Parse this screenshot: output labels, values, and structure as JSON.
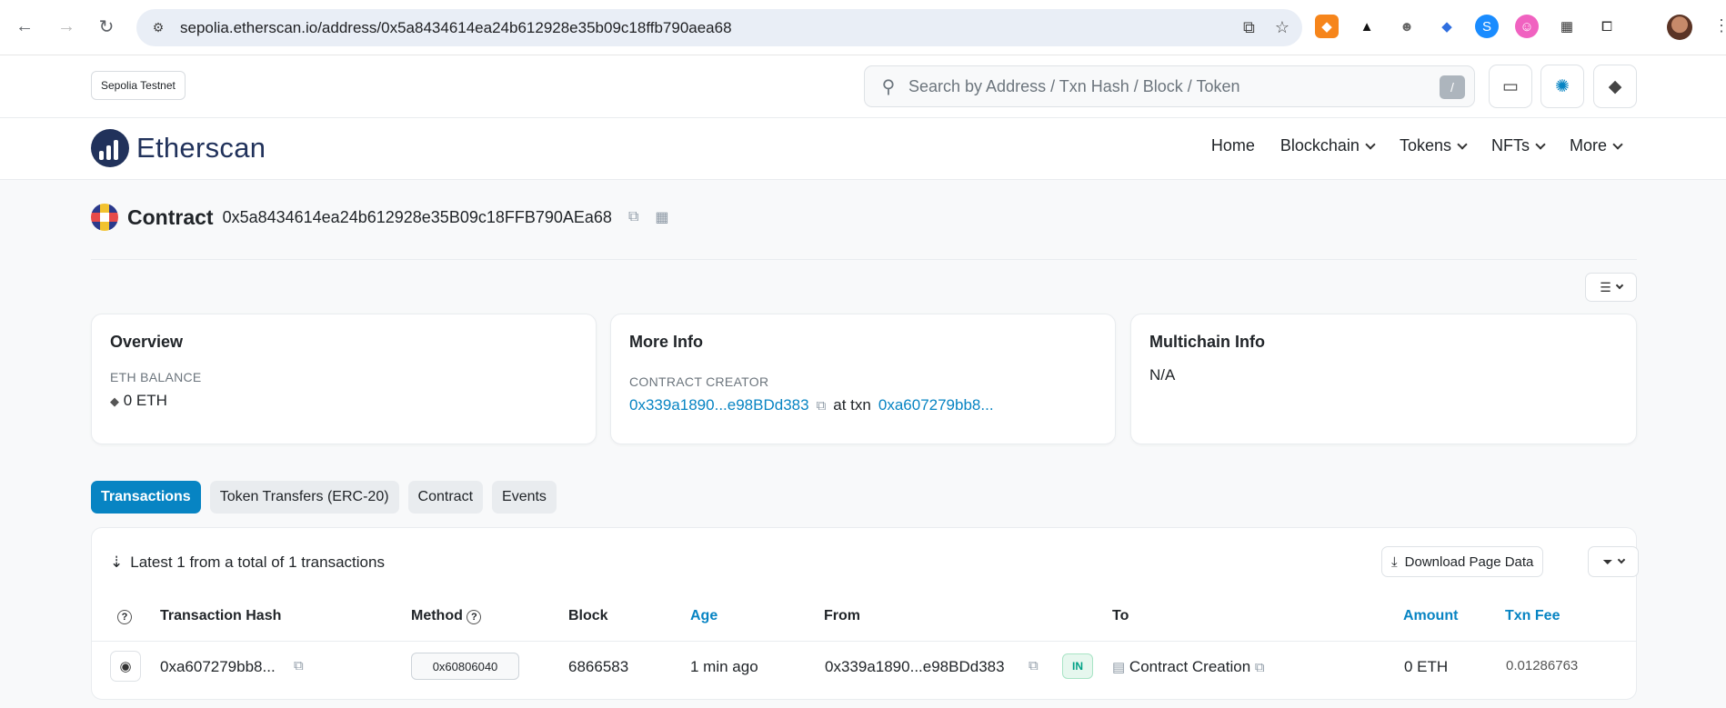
{
  "browser": {
    "url": "sepolia.etherscan.io/address/0x5a8434614ea24b612928e35b09c18ffb790aea68"
  },
  "header": {
    "network": "Sepolia Testnet",
    "search_placeholder": "Search by Address / Txn Hash / Block / Token",
    "search_shortcut": "/"
  },
  "nav": {
    "brand": "Etherscan",
    "items": [
      "Home",
      "Blockchain",
      "Tokens",
      "NFTs",
      "More"
    ]
  },
  "contract": {
    "title": "Contract",
    "address": "0x5a8434614ea24b612928e35B09c18FFB790AEa68"
  },
  "overview": {
    "title": "Overview",
    "balance_label": "ETH BALANCE",
    "balance_value": "0 ETH"
  },
  "more_info": {
    "title": "More Info",
    "creator_label": "CONTRACT CREATOR",
    "creator": "0x339a1890...e98BDd383",
    "at_txn": "at txn",
    "txn": "0xa607279bb8..."
  },
  "multichain": {
    "title": "Multichain Info",
    "value": "N/A"
  },
  "tabs": [
    "Transactions",
    "Token Transfers (ERC-20)",
    "Contract",
    "Events"
  ],
  "transactions": {
    "summary": "Latest 1 from a total of 1 transactions",
    "download_label": "Download Page Data",
    "columns": {
      "hash": "Transaction Hash",
      "method": "Method",
      "block": "Block",
      "age": "Age",
      "from": "From",
      "to": "To",
      "amount": "Amount",
      "fee": "Txn Fee"
    },
    "rows": [
      {
        "hash": "0xa607279bb8...",
        "method": "0x60806040",
        "block": "6866583",
        "age": "1 min ago",
        "from": "0x339a1890...e98BDd383",
        "direction": "IN",
        "to": "Contract Creation",
        "amount": "0 ETH",
        "fee": "0.01286763"
      }
    ]
  },
  "colors": {
    "accent": "#0784c3",
    "brand": "#21325b",
    "in_badge": "#00a186"
  }
}
